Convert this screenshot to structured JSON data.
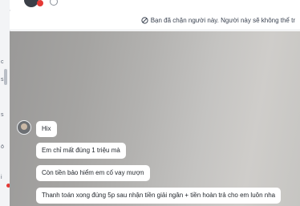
{
  "notice": {
    "text": "Bạn đã chặn người này. Người này sẽ không thể tr"
  },
  "messages": [
    {
      "text": "Hix"
    },
    {
      "text": "Em chỉ mất đúng 1 triệu mà"
    },
    {
      "text": "Còn tiền bảo hiểm em cố vay mượn"
    },
    {
      "text": "Thanh toán xong đúng 5p sau nhận tiền giải ngân + tiền hoàn trả cho em luôn nha"
    }
  ],
  "colors": {
    "bubble": "#ffffff",
    "notice_text": "#3a4250",
    "blocked_badge": "#e53935"
  }
}
